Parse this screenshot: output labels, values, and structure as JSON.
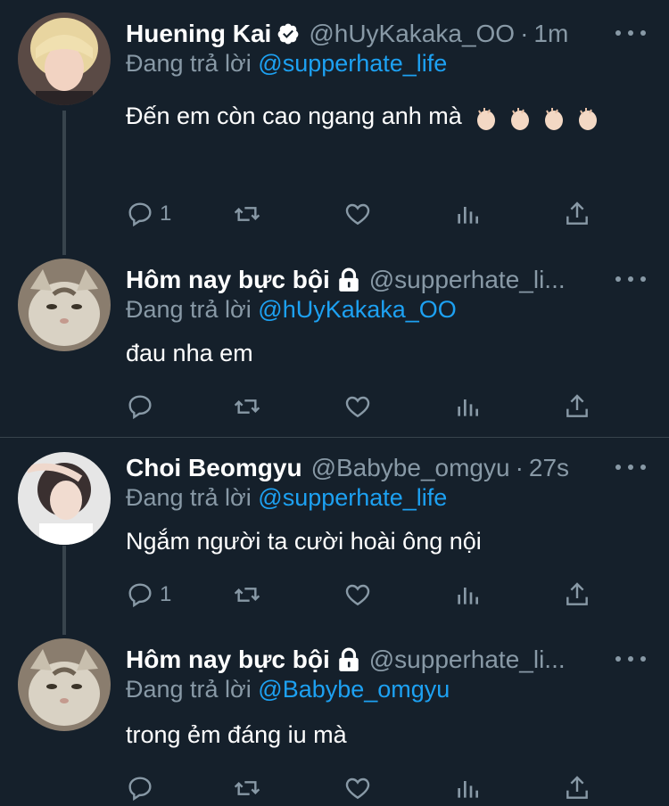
{
  "tweets": [
    {
      "name": "Huening Kai",
      "handle": "@hUyKakaka_OO",
      "time": "1m",
      "reply_prefix": "Đang trả lời",
      "reply_to": "@supperhate_life",
      "text": "Đến em còn cao ngang anh mà",
      "emoji": "clapping-hands x4",
      "reply_count": "1",
      "verified": true,
      "locked": false
    },
    {
      "name": "Hôm nay bực bội",
      "handle": "@supperhate_li...",
      "time": "",
      "reply_prefix": "Đang trả lời",
      "reply_to": "@hUyKakaka_OO",
      "text": "đau nha em",
      "reply_count": "",
      "verified": false,
      "locked": true
    },
    {
      "name": "Choi Beomgyu",
      "handle": "@Babybe_omgyu",
      "time": "27s",
      "reply_prefix": "Đang trả lời",
      "reply_to": "@supperhate_life",
      "text": "Ngắm người ta cười hoài ông nội",
      "reply_count": "1",
      "verified": false,
      "locked": false
    },
    {
      "name": "Hôm nay bực bội",
      "handle": "@supperhate_li...",
      "time": "",
      "reply_prefix": "Đang trả lời",
      "reply_to": "@Babybe_omgyu",
      "text": "trong ẻm đáng iu mà",
      "reply_count": "",
      "verified": false,
      "locked": true
    }
  ],
  "colors": {
    "background": "#15202b",
    "secondary_text": "#8899a6",
    "accent": "#1da1f2",
    "divider": "#38444d"
  },
  "icons": [
    "reply-icon",
    "retweet-icon",
    "like-icon",
    "analytics-icon",
    "share-icon",
    "more-icon",
    "verified-icon",
    "lock-icon"
  ]
}
